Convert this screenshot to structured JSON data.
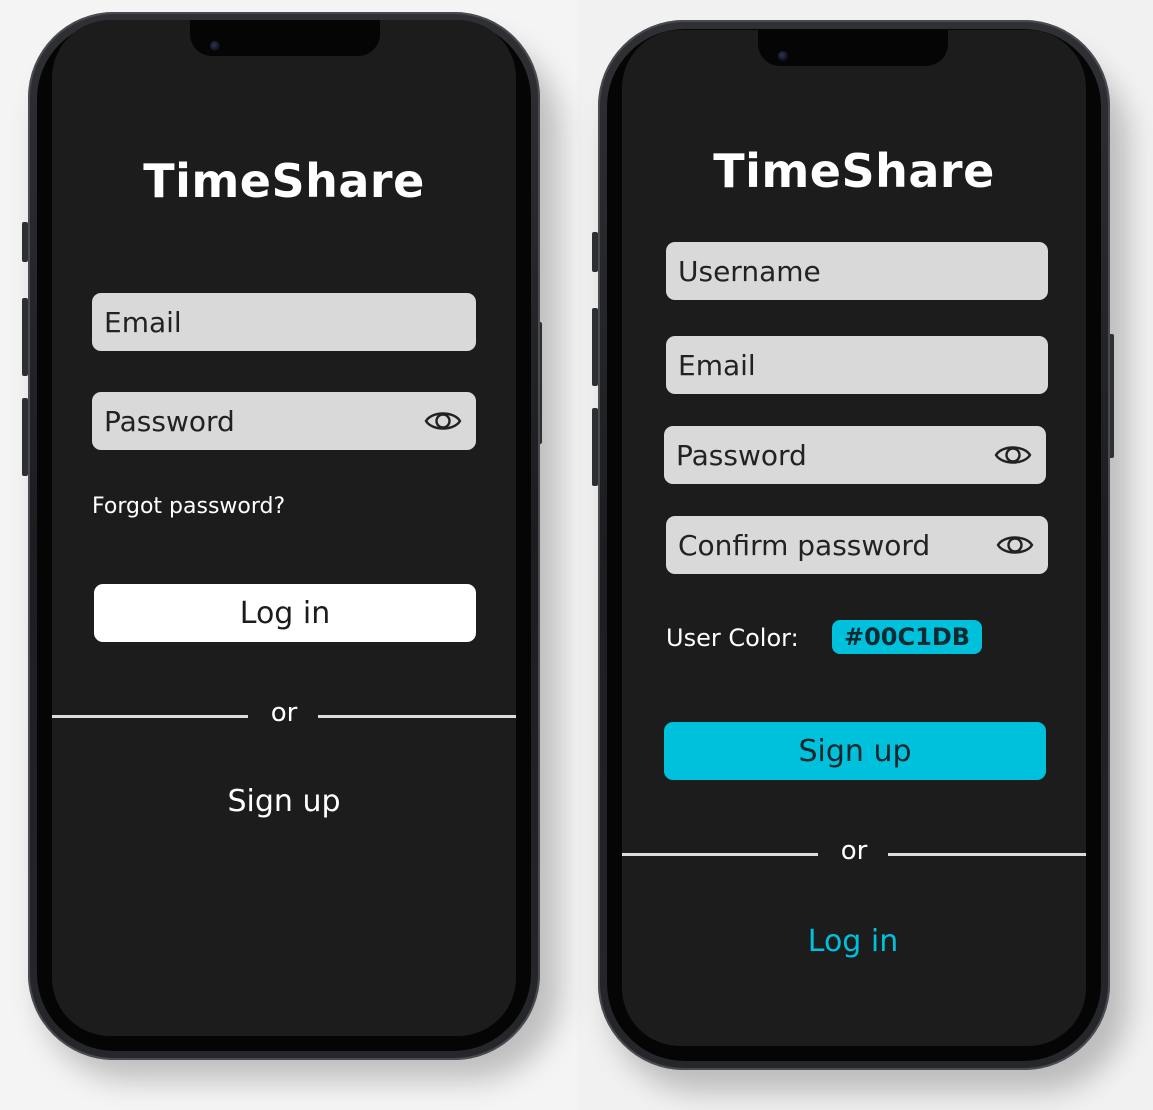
{
  "login": {
    "app_title": "TimeShare",
    "email_placeholder": "Email",
    "password_placeholder": "Password",
    "forgot_password": "Forgot password?",
    "login_button": "Log in",
    "divider_or": "or",
    "signup_link": "Sign up",
    "icons": {
      "password_toggle": "eye-icon"
    }
  },
  "signup": {
    "app_title": "TimeShare",
    "username_placeholder": "Username",
    "email_placeholder": "Email",
    "password_placeholder": "Password",
    "confirm_password_placeholder": "Confirm password",
    "user_color_label": "User Color:",
    "user_color_value": "#00C1DB",
    "signup_button": "Sign up",
    "divider_or": "or",
    "login_link": "Log in",
    "icons": {
      "password_toggle": "eye-icon"
    }
  },
  "colors": {
    "screen_background": "#1C1C1C",
    "field_background": "#D9D9D9",
    "accent": "#00C1DB",
    "login_button_background": "#FFFFFF"
  }
}
